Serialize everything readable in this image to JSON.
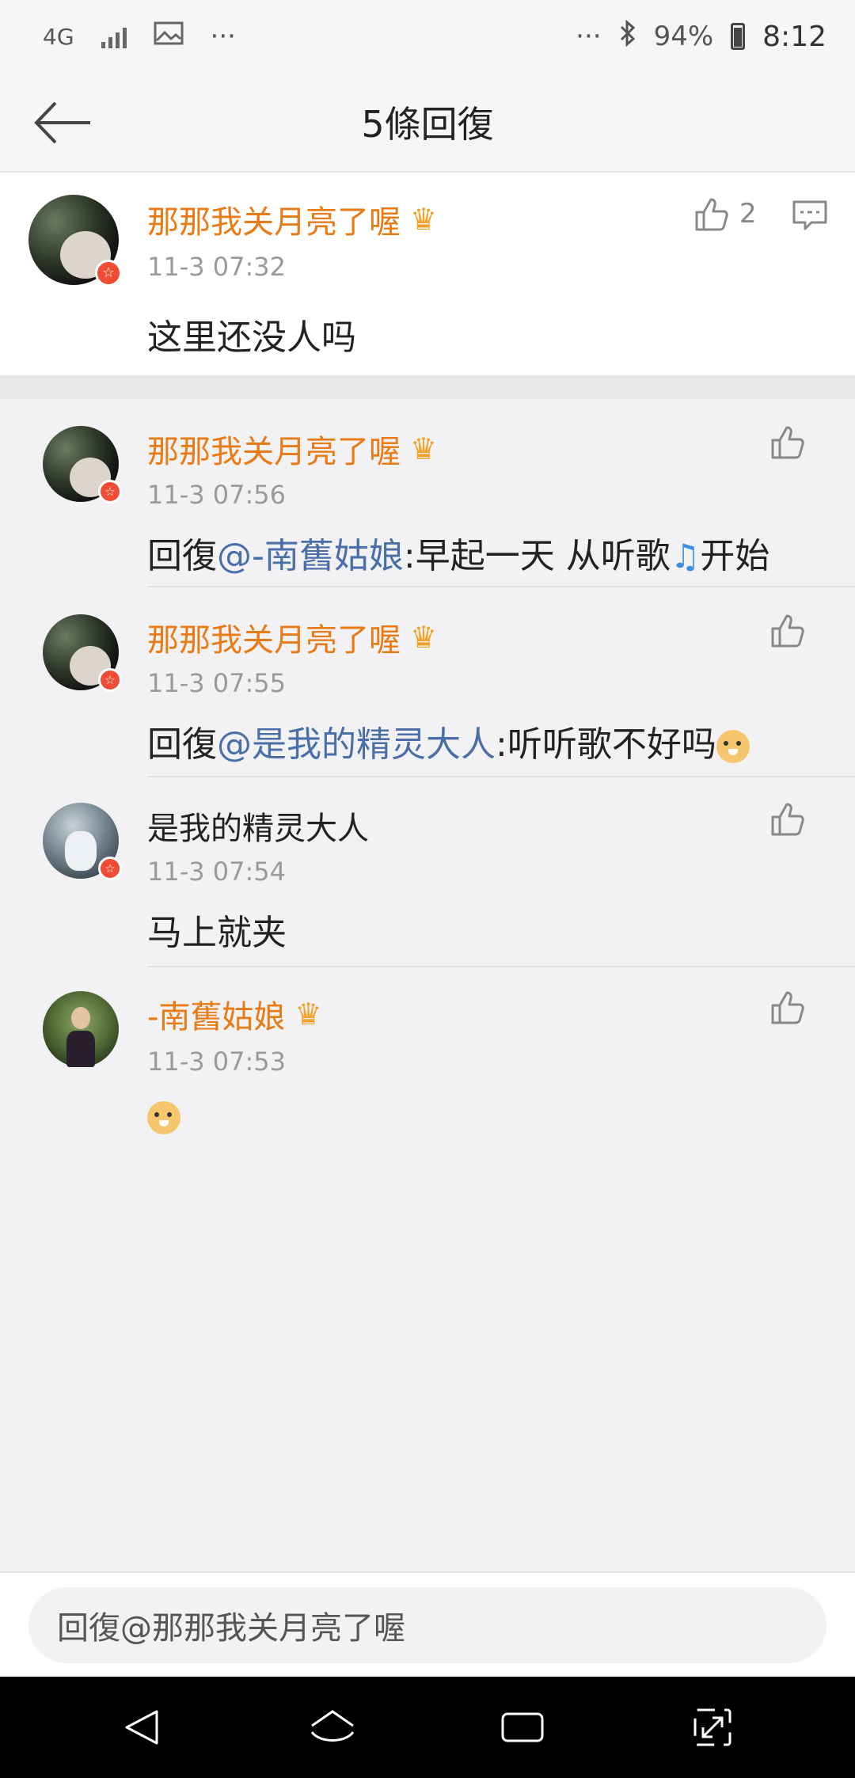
{
  "status_bar": {
    "network": "4G",
    "more": "···",
    "more_right": "···",
    "battery": "94%",
    "time": "8:12"
  },
  "header": {
    "title": "5條回復"
  },
  "main_comment": {
    "user": "那那我关月亮了喔",
    "time": "11-3 07:32",
    "text": "这里还没人吗",
    "likes": "2"
  },
  "replies": [
    {
      "user": "那那我关月亮了喔",
      "time": "11-3 07:56",
      "prefix": "回復",
      "mention": "@-南舊姑娘",
      "text": ":早起一天 从听歌",
      "suffix": "开始",
      "emoji": "music-note"
    },
    {
      "user": "那那我关月亮了喔",
      "time": "11-3 07:55",
      "prefix": "回復",
      "mention": "@是我的精灵大人",
      "text": ":听听歌不好吗",
      "emoji": "doge"
    },
    {
      "user": "是我的精灵大人",
      "time": "11-3 07:54",
      "text": "马上就夹"
    },
    {
      "user": "-南舊姑娘",
      "time": "11-3 07:53",
      "emoji": "doge"
    }
  ],
  "input": {
    "placeholder": "回復@那那我关月亮了喔"
  }
}
